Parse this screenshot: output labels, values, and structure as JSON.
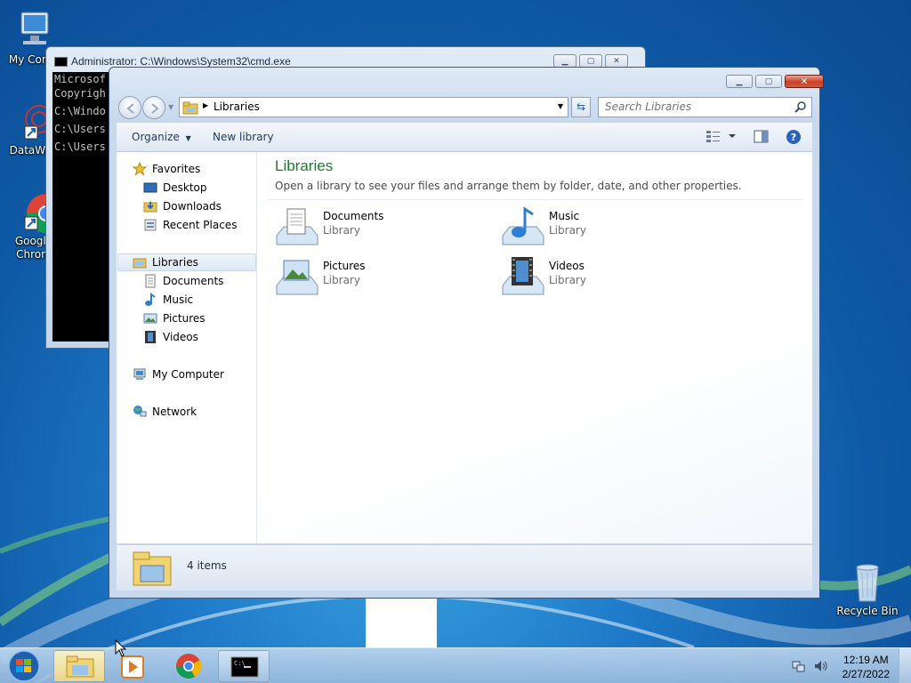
{
  "desktop": {
    "icons": [
      {
        "label": "My Comp"
      },
      {
        "label": "DataWag"
      },
      {
        "label": "Google",
        "label2": "Chrom"
      },
      {
        "label": "Recycle Bin"
      }
    ]
  },
  "cmd_window": {
    "title": "Administrator: C:\\Windows\\System32\\cmd.exe",
    "lines": [
      "Microsof",
      "Copyrigh",
      "",
      "C:\\Windo",
      "",
      "C:\\Users",
      "",
      "C:\\Users"
    ]
  },
  "explorer": {
    "address": "Libraries",
    "search_placeholder": "Search Libraries",
    "toolbar": {
      "organize": "Organize",
      "new_library": "New library"
    },
    "nav": {
      "favorites": "Favorites",
      "favorites_items": [
        "Desktop",
        "Downloads",
        "Recent Places"
      ],
      "libraries": "Libraries",
      "libraries_items": [
        "Documents",
        "Music",
        "Pictures",
        "Videos"
      ],
      "computer": "My Computer",
      "network": "Network"
    },
    "main": {
      "title": "Libraries",
      "description": "Open a library to see your files and arrange them by folder, date, and other properties.",
      "items": [
        {
          "name": "Documents",
          "type": "Library"
        },
        {
          "name": "Music",
          "type": "Library"
        },
        {
          "name": "Pictures",
          "type": "Library"
        },
        {
          "name": "Videos",
          "type": "Library"
        }
      ]
    },
    "status": "4 items"
  },
  "taskbar": {
    "time": "12:19 AM",
    "date": "2/27/2022"
  }
}
